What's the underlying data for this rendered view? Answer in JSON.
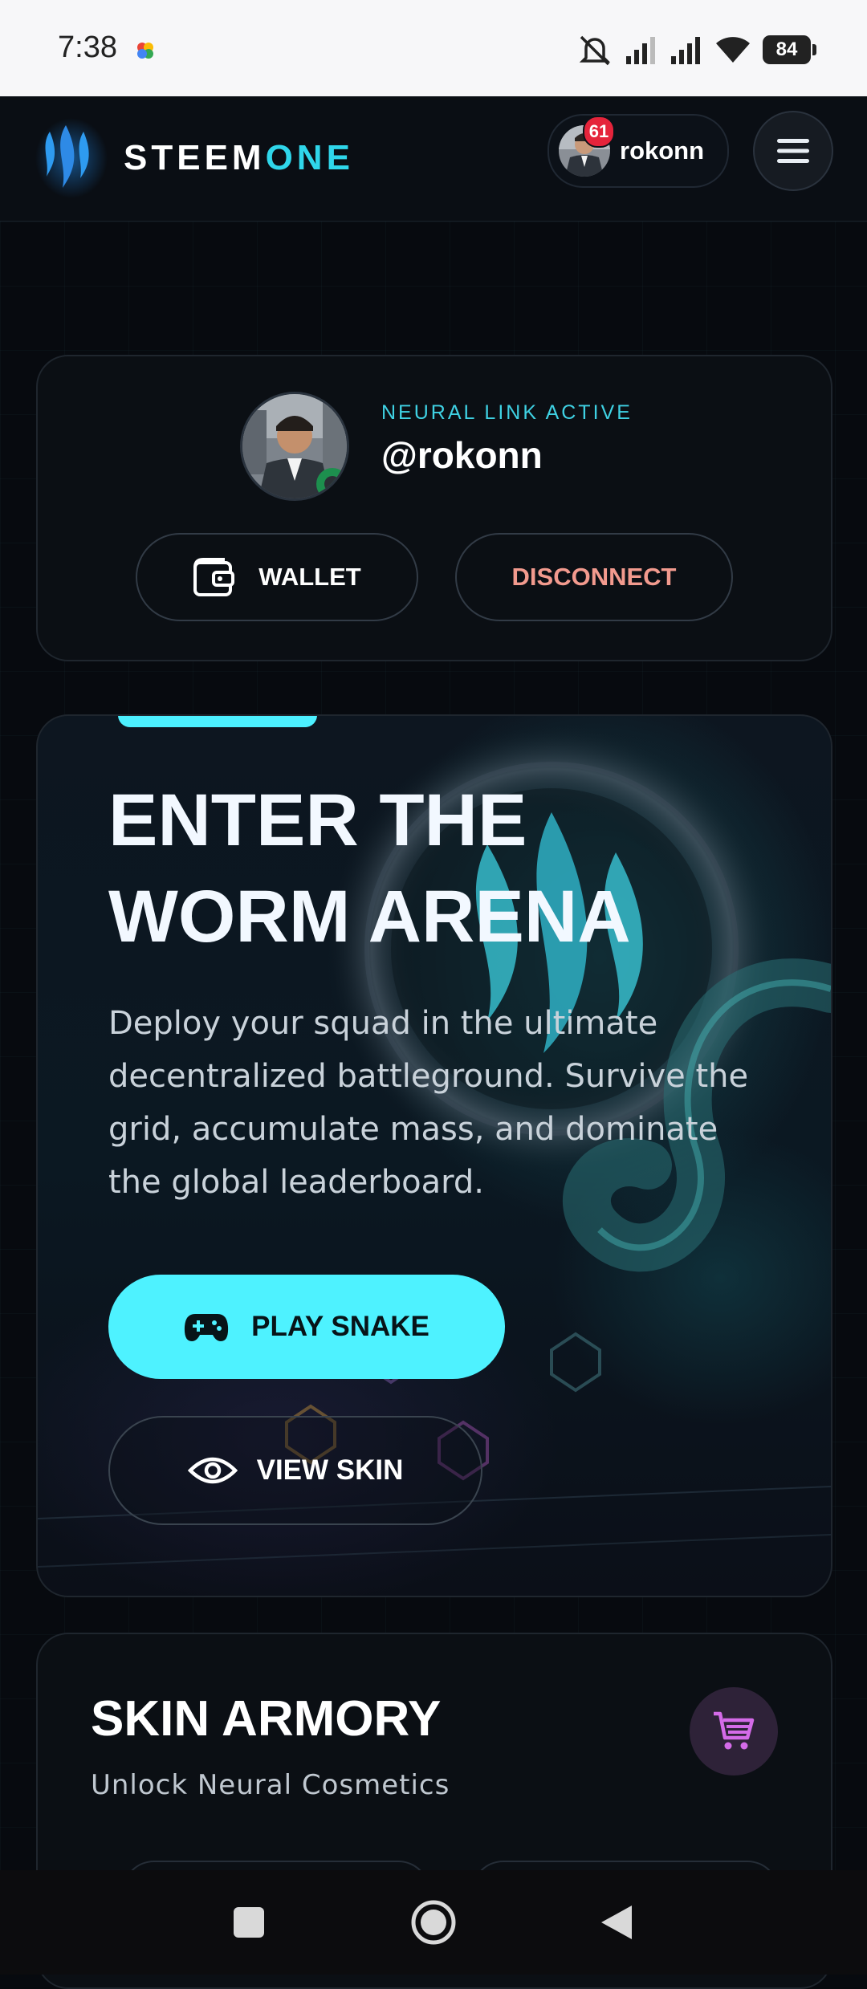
{
  "status_bar": {
    "time": "7:38",
    "battery": "84",
    "icons": [
      "photos-pinwheel-icon",
      "mute-icon",
      "signal-icon",
      "signal-icon",
      "wifi-icon",
      "battery-icon"
    ]
  },
  "header": {
    "brand_primary": "STEEM",
    "brand_accent": "ONE",
    "user_chip": {
      "name": "rokonn",
      "notification_count": "61"
    },
    "menu_icon": "hamburger-icon"
  },
  "profile": {
    "status": "NEURAL LINK ACTIVE",
    "handle": "@rokonn",
    "wallet_label": "WALLET",
    "disconnect_label": "DISCONNECT"
  },
  "hero": {
    "title": "ENTER THE WORM ARENA",
    "description": "Deploy your squad in the ultimate decentralized battleground. Survive the grid, accumulate mass, and dominate the global leaderboard.",
    "play_label": "PLAY SNAKE",
    "view_label": "VIEW SKIN"
  },
  "armory": {
    "title": "SKIN ARMORY",
    "subtitle": "Unlock Neural Cosmetics"
  },
  "colors": {
    "accent_cyan": "#4ef2ff",
    "brand_cyan": "#2fd6ea",
    "disconnect": "#f29a8e",
    "cart_purple": "#d46be8",
    "badge_red": "#e5243b",
    "background": "#070a0f"
  }
}
